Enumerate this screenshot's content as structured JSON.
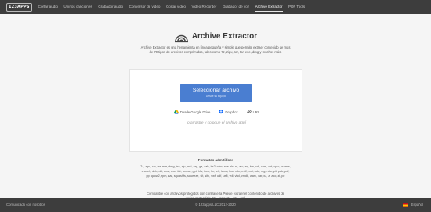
{
  "nav": {
    "logo": "123APPS",
    "items": [
      {
        "label": "Cortar audio",
        "active": false
      },
      {
        "label": "Unirlos canciones",
        "active": false
      },
      {
        "label": "Grabador audio",
        "active": false
      },
      {
        "label": "Conversor de video",
        "active": false
      },
      {
        "label": "Cortar video",
        "active": false
      },
      {
        "label": "Video Recorder",
        "active": false
      },
      {
        "label": "Grabador de voz",
        "active": false
      },
      {
        "label": "Archive Extractor",
        "active": true
      },
      {
        "label": "PDF Tools",
        "active": false
      }
    ]
  },
  "header": {
    "title": "Archive Extractor",
    "description": "Archive Extractor es una herramienta en línea pequeña y simple que permite extraer contenido de más de 70 tipos de archivos comprimidos, tales como 7z, zipx, rar, tar, exe, dmg y muchos más."
  },
  "upload": {
    "button_label": "Seleccionar archivo",
    "button_sublabel": "Desde su equipo",
    "sources": [
      {
        "label": "Desde Google Drive",
        "icon": "google-drive-icon"
      },
      {
        "label": "Dropbox",
        "icon": "dropbox-icon"
      },
      {
        "label": "URL",
        "icon": "link-icon"
      }
    ],
    "drop_hint": "o arrastre y coloque el archivo aquí"
  },
  "formats": {
    "title": "Formatos admitidos:",
    "list": "7z, zipx, rar, tar, exe, dmg, iso, zip, msi, nrg, gz, cab, bz2, wim, ace alz, ar, arc, arj, bin, cdi, chm, cpt, cpio, cramfs, crunch, deb, dd, dms, exe, fat, format, gpt, hfs, ihex, lbr, lzh, lzma, lzw, mbr, mdf, msi, nds, nrg, ntfs, pit, pak, pdf, pp, qcow2, rpm, sar, squashfs, squeeze, sit, sitx, swf, udf, uefi, vdi, vhd, vmdk, warc, xar, xz, z, zoo, zi, pe",
    "compat": "Compatible con archivos protegidos con contraseña Puede extraer el contenido de archivos de varias partes (zip.001, rar.part1, z01, etc)"
  },
  "footer": {
    "left": "Comunicado con nosotros",
    "center": "© 123apps LLC 2012-2020",
    "language": "Español"
  },
  "colors": {
    "nav_bg": "#3d3d3d",
    "accent": "#4a7ed1",
    "page_bg": "#f5f5f5"
  }
}
